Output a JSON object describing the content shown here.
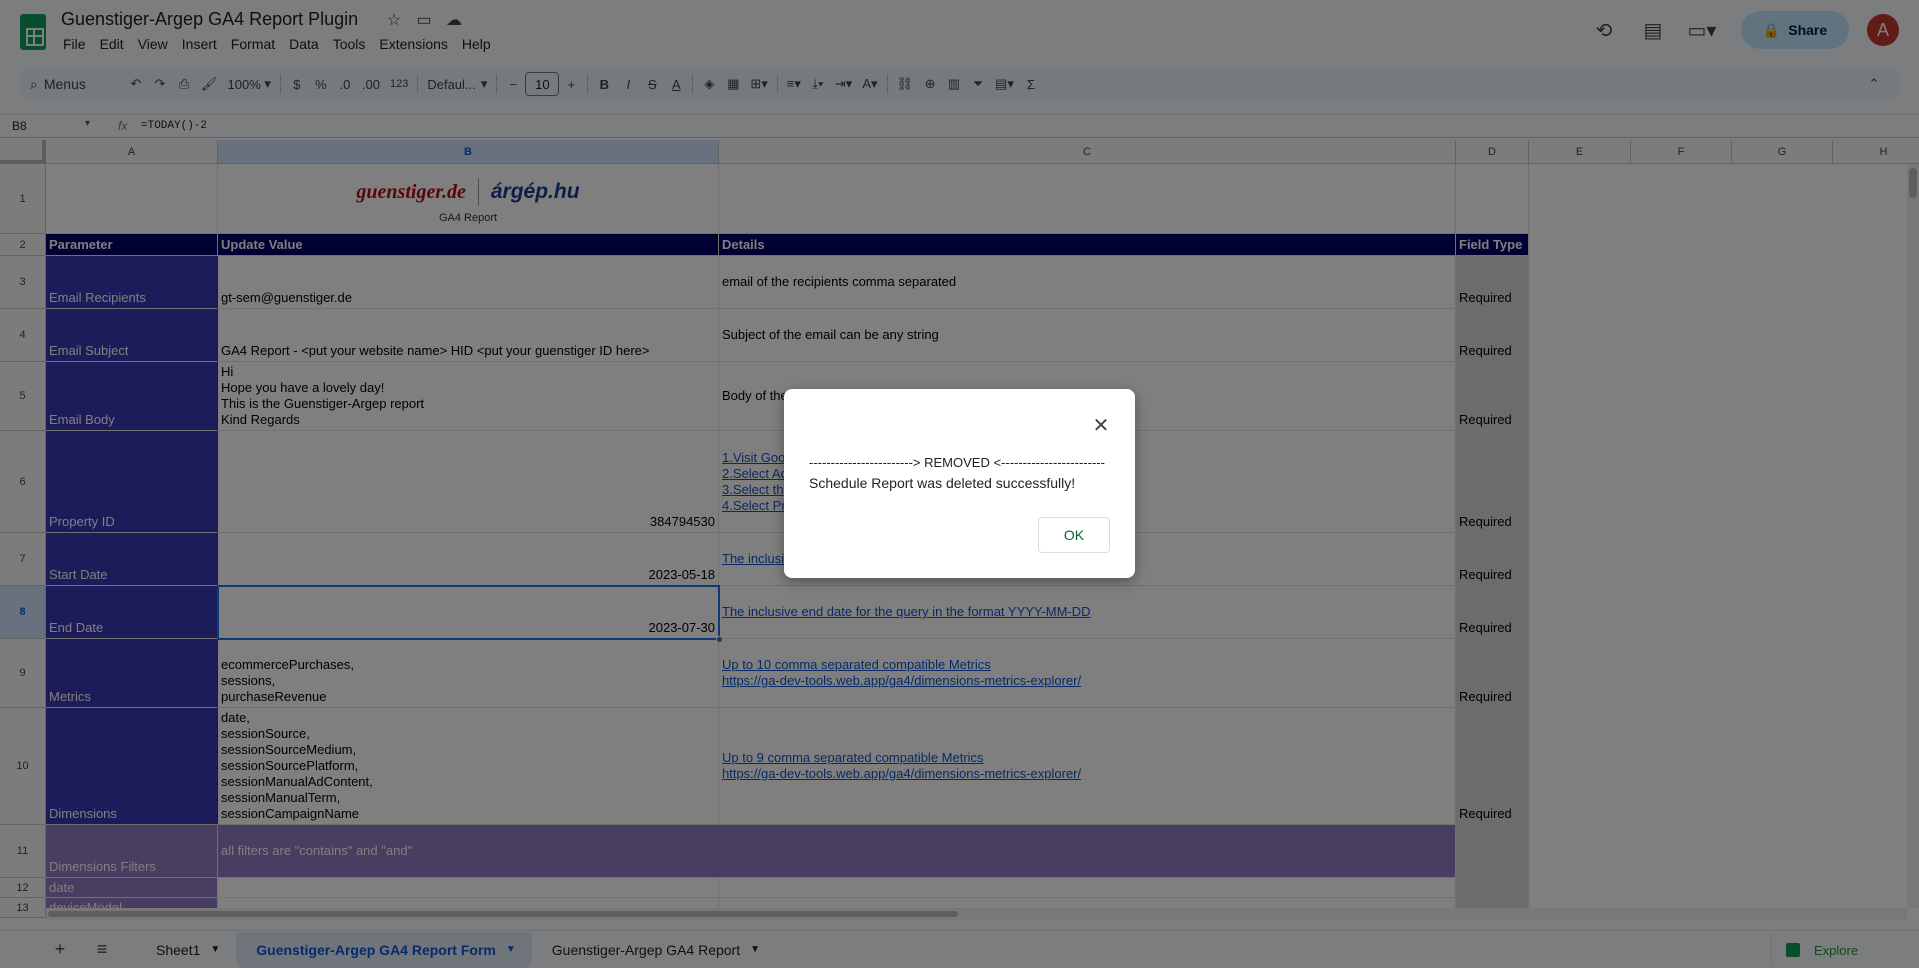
{
  "doc": {
    "title": "Guenstiger-Argep GA4 Report Plugin",
    "menus": [
      "File",
      "Edit",
      "View",
      "Insert",
      "Format",
      "Data",
      "Tools",
      "Extensions",
      "Help"
    ],
    "share_label": "Share",
    "avatar_initial": "A"
  },
  "toolbar": {
    "search_label": "Menus",
    "zoom": "100%",
    "currency": "$",
    "percent": "%",
    "dec_less": ".0",
    "dec_more": ".00",
    "number_format": "123",
    "font": "Defaul...",
    "font_size": "10",
    "bold": "B",
    "italic": "I",
    "strike": "S",
    "text_color": "A"
  },
  "formula_bar": {
    "cell_ref": "B8",
    "fx": "fx",
    "formula": "=TODAY()-2"
  },
  "columns": [
    "A",
    "B",
    "C",
    "D",
    "E",
    "F",
    "G",
    "H"
  ],
  "selected_column": "B",
  "rows": [
    "1",
    "2",
    "3",
    "4",
    "5",
    "6",
    "7",
    "8",
    "9",
    "10",
    "11",
    "12",
    "13"
  ],
  "selected_row": "8",
  "header_row": {
    "parameter": "Parameter",
    "update_value": "Update Value",
    "details": "Details",
    "field_type": "Field Type"
  },
  "banner": {
    "brand1": "guenstiger.de",
    "brand2": "árgép.hu",
    "subtitle": "GA4 Report"
  },
  "sheet_rows": [
    {
      "param": "Email Recipients",
      "value": "gt-sem@guenstiger.de",
      "details": "email of the recipients comma separated",
      "field_type": "Required"
    },
    {
      "param": "Email Subject",
      "value": "GA4 Report - <put your website name> HID <put your guenstiger ID here>",
      "details": "Subject of the email can be any string",
      "field_type": "Required"
    },
    {
      "param": "Email Body",
      "value": "Hi\nHope you have a lovely day!\nThis is the Guenstiger-Argep report\nKind Regards",
      "details": "Body of the",
      "field_type": "Required"
    },
    {
      "param": "Property ID",
      "value": "384794530",
      "details": "1.Visit Goo\n2.Select Ac\n3.Select th\n4.Select Pr",
      "field_type": "Required"
    },
    {
      "param": "Start Date",
      "value": "2023-05-18",
      "details": "The inclusi",
      "field_type": "Required"
    },
    {
      "param": "End Date",
      "value": "2023-07-30",
      "details": "The inclusive end date for the query in the format YYYY-MM-DD",
      "field_type": "Required"
    },
    {
      "param": "Metrics",
      "value": "ecommercePurchases,\nsessions,\npurchaseRevenue",
      "details": "Up to 10 comma separated compatible Metrics\nhttps://ga-dev-tools.web.app/ga4/dimensions-metrics-explorer/",
      "field_type": "Required"
    },
    {
      "param": "Dimensions",
      "value": "date,\nsessionSource,\nsessionSourceMedium,\nsessionSourcePlatform,\nsessionManualAdContent,\nsessionManualTerm,\nsessionCampaignName",
      "details": "Up to 9 comma separated compatible Metrics\nhttps://ga-dev-tools.web.app/ga4/dimensions-metrics-explorer/",
      "field_type": "Required"
    },
    {
      "param": "Dimensions Filters",
      "value": "all filters are \"contains\" and \"and\"",
      "details": "",
      "field_type": ""
    },
    {
      "param": "date",
      "value": "",
      "details": "",
      "field_type": ""
    },
    {
      "param": "deviceModel",
      "value": "",
      "details": "",
      "field_type": ""
    }
  ],
  "sheet_tabs": [
    {
      "label": "Sheet1",
      "active": false
    },
    {
      "label": "Guenstiger-Argep GA4 Report Form",
      "active": true
    },
    {
      "label": "Guenstiger-Argep GA4 Report",
      "active": false
    }
  ],
  "explore_label": "Explore",
  "dialog": {
    "line1": "------------------------> REMOVED <------------------------",
    "line2": "Schedule Report was deleted successfully!",
    "ok_label": "OK"
  },
  "colors": {
    "param_bg": "#3a39b4",
    "header_bg": "#000066",
    "filters_bg": "#8e7cc3",
    "field_type_bg": "#d9d9d9",
    "link": "#1155cc",
    "share_bg": "#c2e7ff"
  }
}
